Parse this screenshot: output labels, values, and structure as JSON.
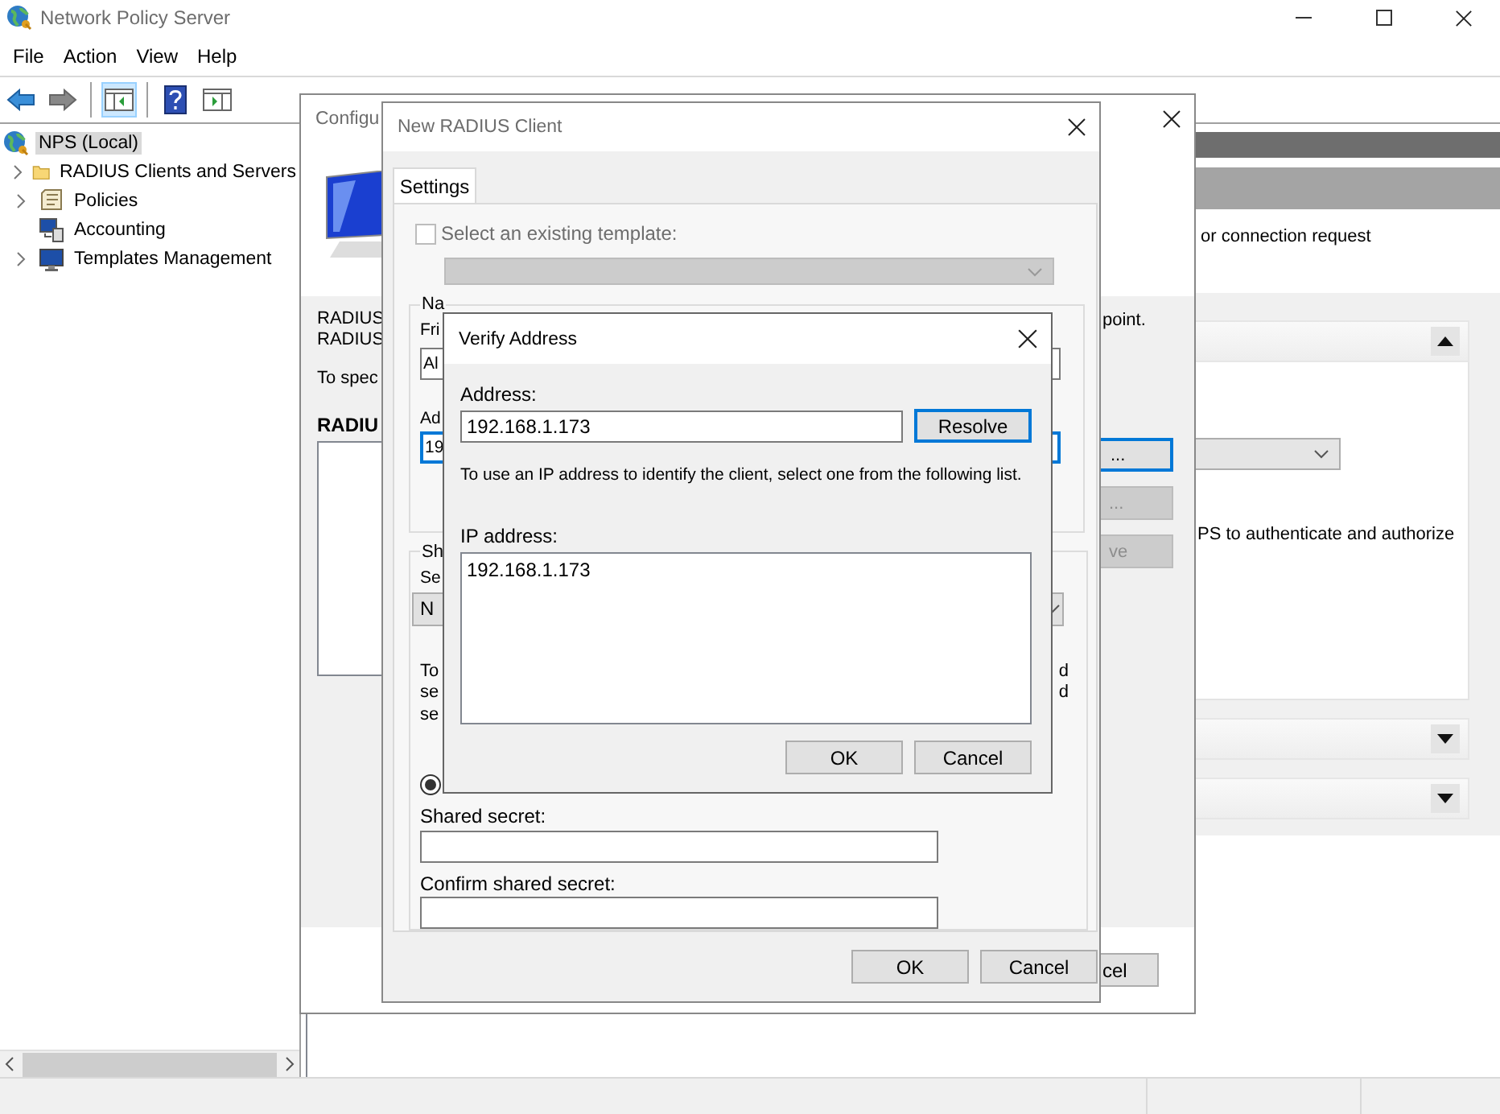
{
  "window": {
    "title": "Network Policy Server"
  },
  "menu": [
    "File",
    "Action",
    "View",
    "Help"
  ],
  "tree": [
    {
      "label": "NPS (Local)",
      "kind": "server",
      "selected": true,
      "children": [
        {
          "label": "RADIUS Clients and Servers",
          "kind": "folder",
          "selected": false,
          "expandable": true
        },
        {
          "label": "Policies",
          "kind": "scroll",
          "selected": false,
          "expandable": true
        },
        {
          "label": "Accounting",
          "kind": "accounting",
          "selected": false,
          "expandable": false
        },
        {
          "label": "Templates Management",
          "kind": "monitor",
          "selected": false,
          "expandable": true
        }
      ]
    }
  ],
  "right_pane": {
    "text": "or connection request",
    "sections": [
      {
        "expanded": true,
        "text": "PS to authenticate and authorize"
      },
      {
        "expanded": false
      },
      {
        "expanded": false
      }
    ]
  },
  "configure_dialog": {
    "title": "Configu",
    "lines": [
      "RADIUS",
      "RADIUS"
    ],
    "hint": "To spec",
    "heading": "RADIU",
    "right_text": "point.",
    "buttons": [
      {
        "label": "...",
        "focused": true,
        "disabled": false
      },
      {
        "label": "...",
        "focused": false,
        "disabled": true
      },
      {
        "label": "ve",
        "focused": false,
        "disabled": true
      }
    ],
    "footer_button": "cel"
  },
  "new_client_dialog": {
    "title": "New RADIUS Client",
    "tab": {
      "label": "Settings",
      "selected": true
    },
    "template": {
      "label": "Select an existing template:",
      "checked": false,
      "disabled": true
    },
    "name_group": {
      "legend": "Na",
      "friendly_label": "Fri",
      "friendly_value": "Al",
      "address_label": "Ad",
      "address_value": "19"
    },
    "secret_group": {
      "legend": "Sh",
      "select_label": "Se",
      "select_value": "N",
      "text_left": [
        "To",
        "se",
        "se"
      ],
      "text_right": [
        "d",
        "d"
      ],
      "radio_selected": true,
      "shared_label": "Shared secret:",
      "confirm_label": "Confirm shared secret:"
    },
    "buttons": [
      "OK",
      "Cancel"
    ]
  },
  "verify_dialog": {
    "title": "Verify Address",
    "address_label": "Address:",
    "address_value": "192.168.1.173",
    "resolve": "Resolve",
    "hint": "To use an IP address to identify the client, select one from the following list.",
    "list_label": "IP address:",
    "items": [
      {
        "label": "192.168.1.173",
        "selected": false
      }
    ],
    "buttons": [
      "OK",
      "Cancel"
    ]
  }
}
